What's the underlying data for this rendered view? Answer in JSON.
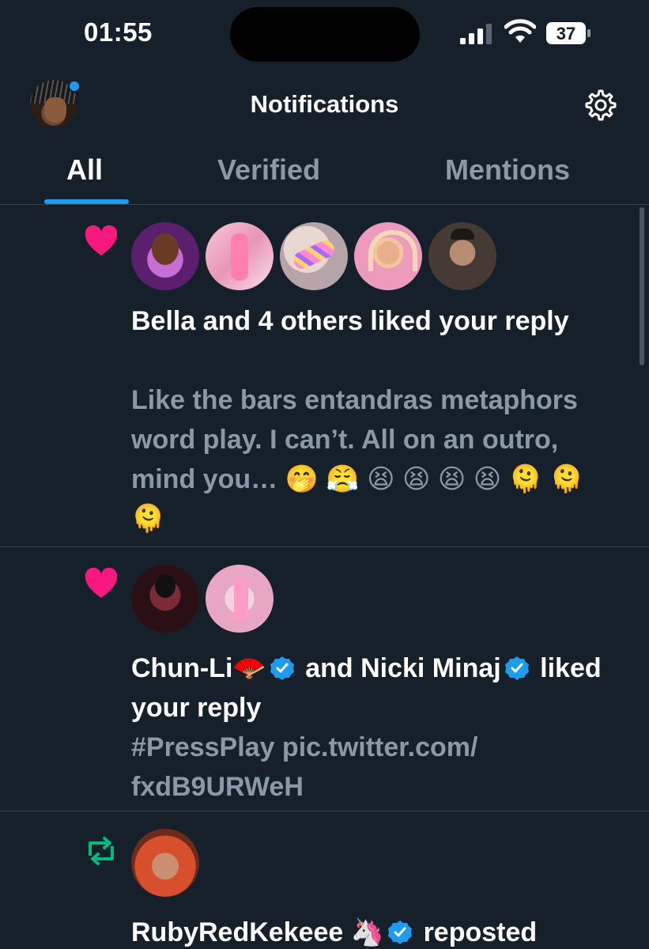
{
  "status_bar": {
    "time": "01:55",
    "battery": "37"
  },
  "header": {
    "title": "Notifications"
  },
  "tabs": [
    {
      "label": "All",
      "active": true
    },
    {
      "label": "Verified",
      "active": false
    },
    {
      "label": "Mentions",
      "active": false
    }
  ],
  "notifications": [
    {
      "type": "like",
      "icon": "heart-icon",
      "title": "Bella and 4 others liked your reply",
      "body": "Like the bars entandras metaphors word play. I can’t. All on an outro, mind you… 🤭 😤 😫 😫 😫 😫 🫠 🫠 🫠",
      "avatars": [
        "Bella",
        "pink-room",
        "nails",
        "blonde",
        "man"
      ]
    },
    {
      "type": "like",
      "icon": "heart-icon",
      "user1": "Chun-Li🪭",
      "connector": "and",
      "user2": "Nicki Minaj",
      "action": "liked your reply",
      "body": "#PressPlay pic.twitter.com/ fxdB9URWeH",
      "avatars": [
        "Chun-Li",
        "Nicki Minaj"
      ]
    },
    {
      "type": "repost",
      "icon": "repost-icon",
      "user1": "RubyRedKekeee 🦄",
      "action": "reposted",
      "avatars": [
        "RubyRedKekeee"
      ]
    }
  ],
  "colors": {
    "background": "#15202b",
    "accent": "#1d9bf0",
    "like": "#f91880",
    "repost": "#00ba7c",
    "secondary_text": "#8b98a5"
  }
}
